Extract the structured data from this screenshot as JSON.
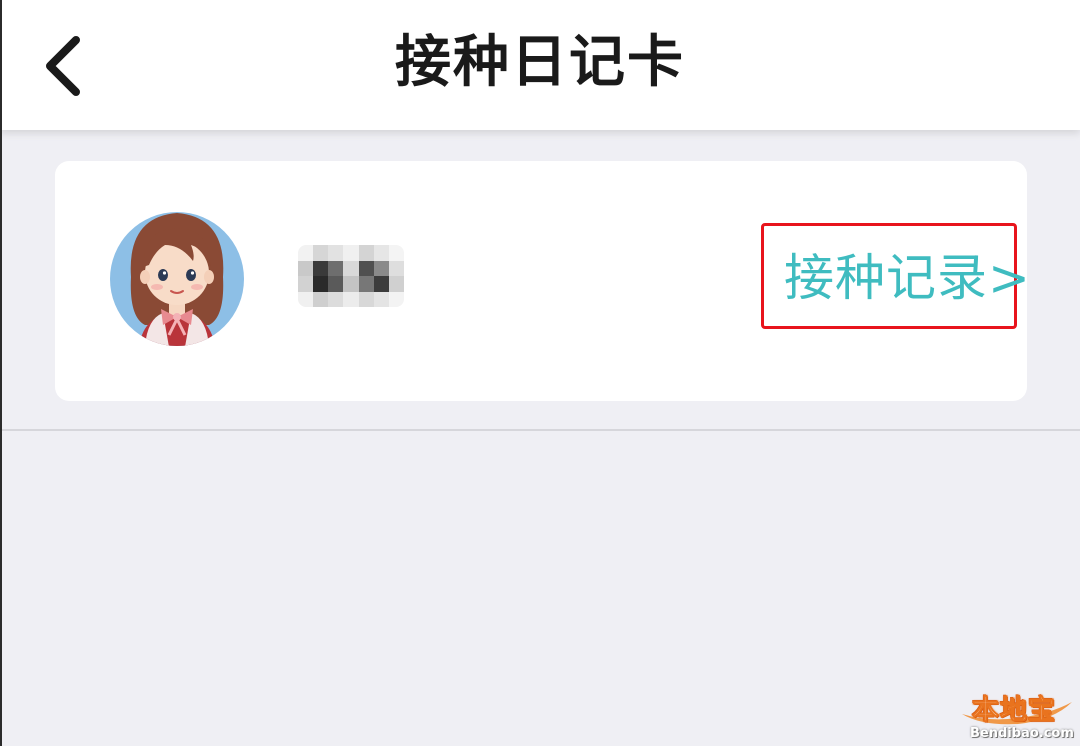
{
  "header": {
    "title": "接种日记卡",
    "back_icon": "chevron-left-icon"
  },
  "card": {
    "avatar_icon": "girl-avatar-icon",
    "user_name": "",
    "record_link_label": "接种记录>",
    "record_link_color": "#3fbcc0",
    "highlight_color": "#e8141c"
  },
  "colors": {
    "background": "#efeff4",
    "header_bg": "#ffffff",
    "card_bg": "#ffffff",
    "avatar_circle": "#8dbfe6"
  },
  "watermark": {
    "logo_text": "本地宝",
    "url": "Bendibao.com"
  }
}
